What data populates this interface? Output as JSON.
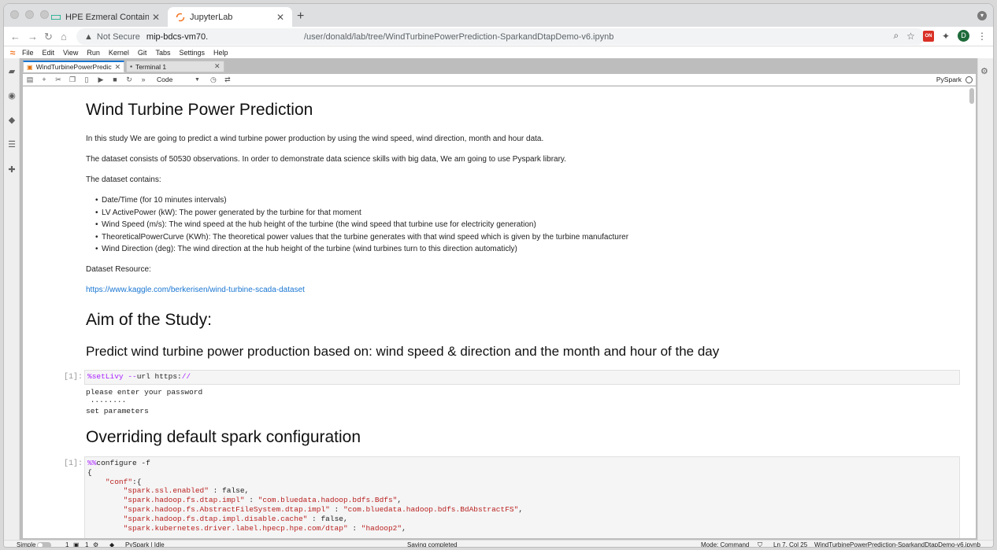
{
  "browser": {
    "tabs": [
      {
        "title": "HPE Ezmeral Container Platfor",
        "active": false
      },
      {
        "title": "JupyterLab",
        "active": true
      }
    ],
    "security": "Not Secure",
    "host": "mip-bdcs-vm70.",
    "path": "/user/donald/lab/tree/WindTurbinePowerPrediction-SparkandDtapDemo-v6.ipynb",
    "ext_label": "ON",
    "avatar_initial": "D"
  },
  "menu": [
    "File",
    "Edit",
    "View",
    "Run",
    "Kernel",
    "Git",
    "Tabs",
    "Settings",
    "Help"
  ],
  "doc_tabs": [
    {
      "title": "WindTurbinePowerPredicti",
      "active": true
    },
    {
      "title": "Terminal 1",
      "active": false
    }
  ],
  "toolbar": {
    "cell_type": "Code",
    "kernel": "PySpark"
  },
  "notebook": {
    "title": "Wind Turbine Power Prediction",
    "intro": "In this study We are going to predict a wind turbine power production by using the wind speed, wind direction, month and hour data.",
    "dataset_info": "The dataset consists of 50530 observations. In order to demonstrate data science skills with big data, We am going to use Pyspark library.",
    "contains_label": "The dataset contains:",
    "bullets": [
      "Date/Time (for 10 minutes intervals)",
      "LV ActivePower (kW): The power generated by the turbine for that moment",
      "Wind Speed (m/s): The wind speed at the hub height of the turbine (the wind speed that turbine use for electricity generation)",
      "TheoreticalPowerCurve (KWh): The theoretical power values that the turbine generates with that wind speed which is given by the turbine manufacturer",
      "Wind Direction (deg): The wind direction at the hub height of the turbine (wind turbines turn to this direction automaticly)"
    ],
    "resource_label": "Dataset Resource:",
    "resource_link": "https://www.kaggle.com/berkerisen/wind-turbine-scada-dataset",
    "aim_title": "Aim of the Study:",
    "aim_subtitle": "Predict wind turbine power production based on: wind speed & direction and the month and hour of the day",
    "cell1_prompt": "[1]:",
    "cell1_magic": "%setLivy",
    "cell1_op": "--",
    "cell1_rest": "url https:",
    "cell1_slash": "//",
    "cell1_output": [
      "please enter your password",
      " ········",
      "set parameters"
    ],
    "override_title": "Overriding default spark configuration",
    "cell2_prompt": "[1]:",
    "cell2_magic": "%%",
    "cell2_first": "configure -f",
    "cell2_lines": [
      {
        "indent": "",
        "key": "",
        "value": "{"
      },
      {
        "indent": "    ",
        "key": "\"conf\"",
        "value": ":{"
      },
      {
        "indent": "        ",
        "key": "\"spark.ssl.enabled\"",
        "value": " : false,"
      },
      {
        "indent": "        ",
        "key": "\"spark.hadoop.fs.dtap.impl\"",
        "value": " : ",
        "str": "\"com.bluedata.hadoop.bdfs.Bdfs\"",
        "tail": ","
      },
      {
        "indent": "        ",
        "key": "\"spark.hadoop.fs.AbstractFileSystem.dtap.impl\"",
        "value": " : ",
        "str": "\"com.bluedata.hadoop.bdfs.BdAbstractFS\"",
        "tail": ","
      },
      {
        "indent": "        ",
        "key": "\"spark.hadoop.fs.dtap.impl.disable.cache\"",
        "value": " : false,"
      },
      {
        "indent": "        ",
        "key": "\"spark.kubernetes.driver.label.hpecp.hpe.com/dtap\"",
        "value": " : ",
        "str": "\"hadoop2\"",
        "tail": ","
      }
    ]
  },
  "status": {
    "mode_label": "Simple",
    "num1": "1",
    "num2": "1",
    "kernel_state": "PySpark | Idle",
    "saving": "Saving completed",
    "mode": "Mode: Command",
    "position": "Ln 7, Col 25",
    "file": "WindTurbinePowerPrediction-SparkandDtapDemo-v6.ipynb"
  }
}
